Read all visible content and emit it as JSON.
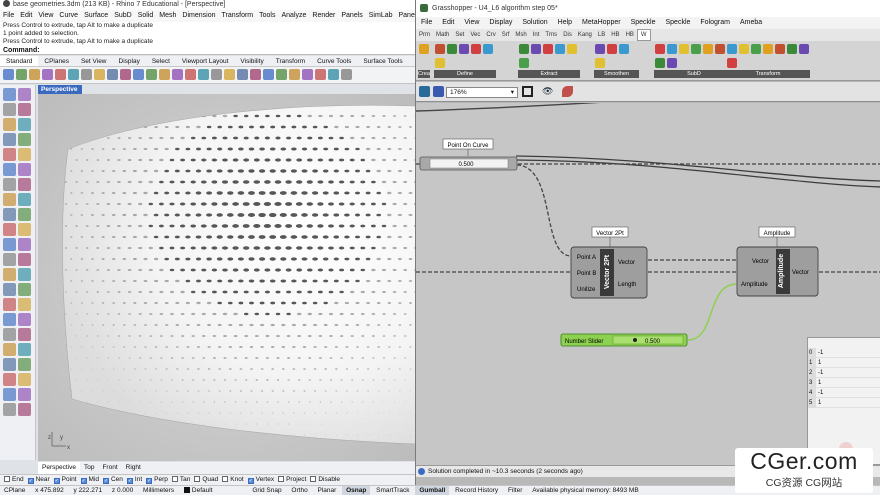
{
  "rhino": {
    "title": "base geometries.3dm (213 KB) - Rhino 7 Educational - [Perspective]",
    "menu": [
      "File",
      "Edit",
      "View",
      "Curve",
      "Surface",
      "SubD",
      "Solid",
      "Mesh",
      "Dimension",
      "Transform",
      "Tools",
      "Analyze",
      "Render",
      "Panels",
      "SimLab",
      "Paneling Tools",
      "Help"
    ],
    "command_history": [
      "Press Control to extrude, tap Alt to make a duplicate",
      "1 point added to selection.",
      "Press Control to extrude, tap Alt to make a duplicate"
    ],
    "command_prompt": "Command:",
    "toolbar_tabs": [
      "Standard",
      "CPlanes",
      "Set View",
      "Display",
      "Select",
      "Viewport Layout",
      "Visibility",
      "Transform",
      "Curve Tools",
      "Surface Tools",
      "So"
    ],
    "viewport_label": "Perspective",
    "viewport_tabs": [
      "Perspective",
      "Top",
      "Front",
      "Right"
    ],
    "axis_labels": {
      "z": "z",
      "x": "x",
      "y": "y"
    },
    "osnaps": [
      {
        "label": "End",
        "checked": false
      },
      {
        "label": "Near",
        "checked": true
      },
      {
        "label": "Point",
        "checked": true
      },
      {
        "label": "Mid",
        "checked": true
      },
      {
        "label": "Cen",
        "checked": true
      },
      {
        "label": "Int",
        "checked": true
      },
      {
        "label": "Perp",
        "checked": true
      },
      {
        "label": "Tan",
        "checked": false
      },
      {
        "label": "Quad",
        "checked": false
      },
      {
        "label": "Knot",
        "checked": false
      },
      {
        "label": "Vertex",
        "checked": true
      },
      {
        "label": "Project",
        "checked": false
      },
      {
        "label": "Disable",
        "checked": false
      }
    ],
    "status": {
      "cplane": "CPlane",
      "x": "x 475.892",
      "y": "y 222.271",
      "z": "z 0.000",
      "units": "Millimeters",
      "layer": "Default",
      "grid_snap": "Grid Snap",
      "ortho": "Ortho",
      "planar": "Planar",
      "osnap": "Osnap",
      "smarttrack": "SmartTrack",
      "gumball": "Gumball",
      "record_history": "Record History",
      "filter": "Filter",
      "memory": "Available physical memory: 8493 MB"
    }
  },
  "grasshopper": {
    "title": "Grasshopper - U4_L6 algorithm step 05*",
    "menu": [
      "File",
      "Edit",
      "View",
      "Display",
      "Solution",
      "Help",
      "MetaHopper",
      "Speckle",
      "Speckle",
      "Fologram",
      "Ameba"
    ],
    "tabs": [
      {
        "label": "Prm",
        "active": false
      },
      {
        "label": "Math",
        "active": false
      },
      {
        "label": "Set",
        "active": false
      },
      {
        "label": "Vec",
        "active": false
      },
      {
        "label": "Crv",
        "active": false
      },
      {
        "label": "Srf",
        "active": false
      },
      {
        "label": "Msh",
        "active": false
      },
      {
        "label": "Int",
        "active": false
      },
      {
        "label": "Trns",
        "active": false
      },
      {
        "label": "Dis",
        "active": false
      },
      {
        "label": "Kang",
        "active": false
      },
      {
        "label": "LB",
        "active": false
      },
      {
        "label": "HB",
        "active": false
      },
      {
        "label": "HB",
        "active": false
      },
      {
        "label": "W",
        "active": true
      }
    ],
    "ribbon_groups": [
      "Crea..",
      "Define",
      "Extract",
      "Smoothen",
      "SubD",
      "Transform"
    ],
    "zoom": "176%",
    "components": {
      "point_on_curve": {
        "label": "Point On Curve",
        "value": "0.500"
      },
      "vector2pt": {
        "label": "Vector 2Pt",
        "name": "Vector 2Pt",
        "inputs": [
          "Point A",
          "Point B",
          "Unitize"
        ],
        "outputs": [
          "Vector",
          "Length"
        ]
      },
      "amplitude": {
        "label": "Amplitude",
        "name": "Amplitude",
        "inputs": [
          "Vector",
          "Amplitude"
        ],
        "outputs": [
          "Vector"
        ]
      },
      "number_slider": {
        "label": "Number Slider",
        "value": "0.500"
      }
    },
    "panel": {
      "rows": [
        {
          "index": "0",
          "value": "-1"
        },
        {
          "index": "1",
          "value": "1"
        },
        {
          "index": "2",
          "value": "-1"
        },
        {
          "index": "3",
          "value": "1"
        },
        {
          "index": "4",
          "value": "-1"
        },
        {
          "index": "5",
          "value": "1"
        }
      ]
    },
    "status": "Solution completed in ~10.3 seconds (2 seconds ago)"
  },
  "watermark": {
    "main": "CGer.com",
    "sub": "CG资源 CG网站"
  },
  "colors": {
    "accent": "#3a6ac0",
    "slider_green": "#86d44a",
    "component_grey": "#9a9a9a",
    "wire": "#555555"
  }
}
